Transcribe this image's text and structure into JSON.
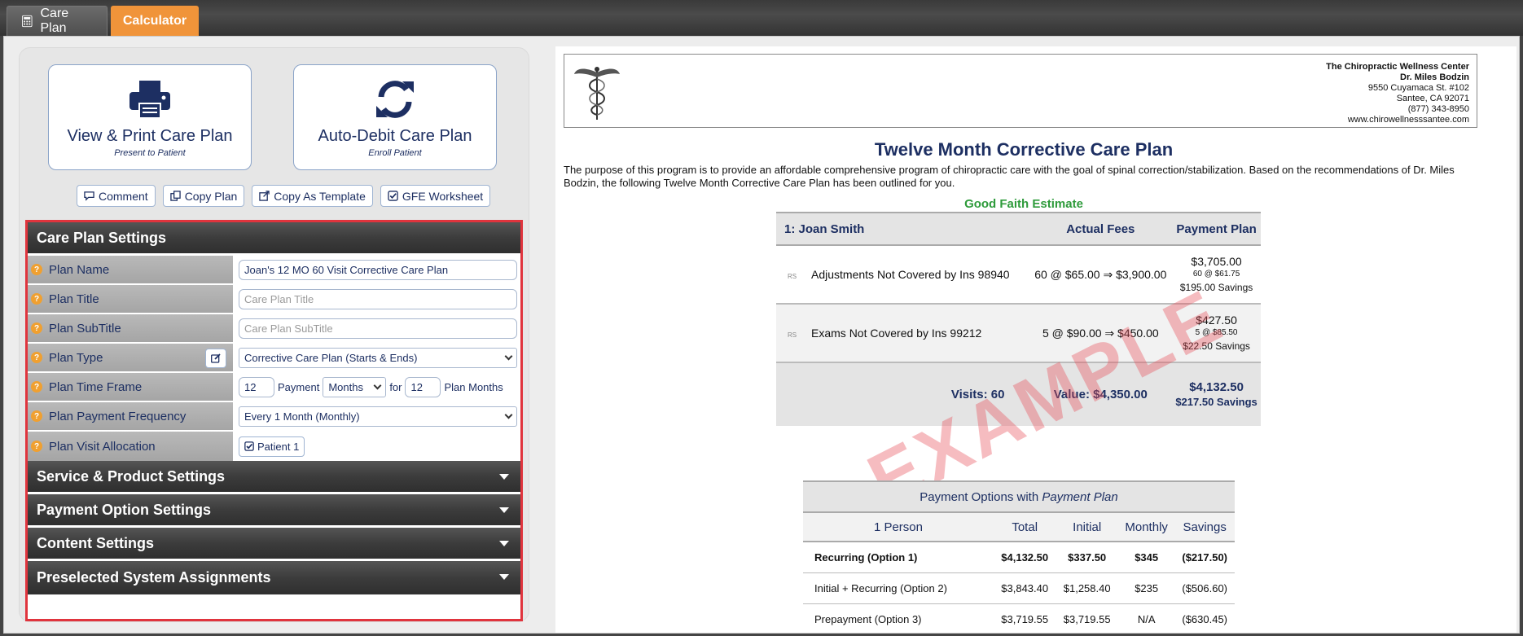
{
  "tabs": [
    {
      "label": "Care Plan",
      "icon": "calculator-icon"
    },
    {
      "label": "Calculator"
    }
  ],
  "actions": {
    "print": {
      "label": "View & Print Care Plan",
      "sub": "Present to Patient"
    },
    "debit": {
      "label": "Auto-Debit Care Plan",
      "sub": "Enroll Patient"
    },
    "small": [
      "Comment",
      "Copy Plan",
      "Copy As Template",
      "GFE Worksheet"
    ]
  },
  "settings": {
    "title": "Care Plan Settings",
    "plan_name_label": "Plan Name",
    "plan_name_value": "Joan's 12 MO 60 Visit Corrective Care Plan",
    "plan_title_label": "Plan Title",
    "plan_title_placeholder": "Care Plan Title",
    "plan_subtitle_label": "Plan SubTitle",
    "plan_subtitle_placeholder": "Care Plan SubTitle",
    "plan_type_label": "Plan Type",
    "plan_type_value": "Corrective Care Plan (Starts & Ends)",
    "time_frame_label": "Plan Time Frame",
    "time_frame_value": "12",
    "payment_text": "Payment",
    "payment_unit": "Months",
    "for_text": "for",
    "plan_months_value": "12",
    "plan_months_text": "Plan Months",
    "frequency_label": "Plan Payment Frequency",
    "frequency_value": "Every 1 Month (Monthly)",
    "visit_alloc_label": "Plan Visit Allocation",
    "visit_alloc_value": "Patient 1"
  },
  "sections": [
    "Service & Product Settings",
    "Payment Option Settings",
    "Content Settings",
    "Preselected System Assignments"
  ],
  "doc": {
    "practice": {
      "name": "The Chiropractic Wellness Center",
      "doctor": "Dr. Miles Bodzin",
      "address1": "9550 Cuyamaca St. #102",
      "address2": "Santee, CA 92071",
      "phone": "(877) 343-8950",
      "web": "www.chirowellnesssantee.com"
    },
    "title": "Twelve Month Corrective Care Plan",
    "intro": "The purpose of this program is to provide an affordable comprehensive program of chiropractic care with the goal of spinal correction/stabilization. Based on the recommendations of Dr. Miles Bodzin, the following Twelve Month Corrective Care Plan has been outlined for you.",
    "gfe": "Good Faith Estimate",
    "watermark": "EXAMPLE",
    "t1": {
      "patient": "1: Joan Smith",
      "col_actual": "Actual Fees",
      "col_plan": "Payment Plan",
      "rows": [
        {
          "code": "RS",
          "desc": "Adjustments Not Covered by Ins 98940",
          "actual": "60 @ $65.00 ⇒ $3,900.00",
          "plan": "$3,705.00",
          "plan_detail": "60 @ $61.75",
          "savings": "$195.00 Savings"
        },
        {
          "code": "RS",
          "desc": "Exams Not Covered by Ins 99212",
          "actual": "5 @ $90.00 ⇒ $450.00",
          "plan": "$427.50",
          "plan_detail": "5 @ $85.50",
          "savings": "$22.50 Savings"
        }
      ],
      "visits": "Visits: 60",
      "value": "Value: $4,350.00",
      "total": "$4,132.50",
      "total_savings": "$217.50 Savings"
    },
    "t2": {
      "caption_prefix": "Payment Options with ",
      "caption_em": "Payment Plan",
      "headers": [
        "1 Person",
        "Total",
        "Initial",
        "Monthly",
        "Savings"
      ],
      "rows": [
        [
          "Recurring (Option 1)",
          "$4,132.50",
          "$337.50",
          "$345",
          "($217.50)"
        ],
        [
          "Initial + Recurring (Option 2)",
          "$3,843.40",
          "$1,258.40",
          "$235",
          "($506.60)"
        ],
        [
          "Prepayment (Option 3)",
          "$3,719.55",
          "$3,719.55",
          "N/A",
          "($630.45)"
        ]
      ]
    }
  }
}
